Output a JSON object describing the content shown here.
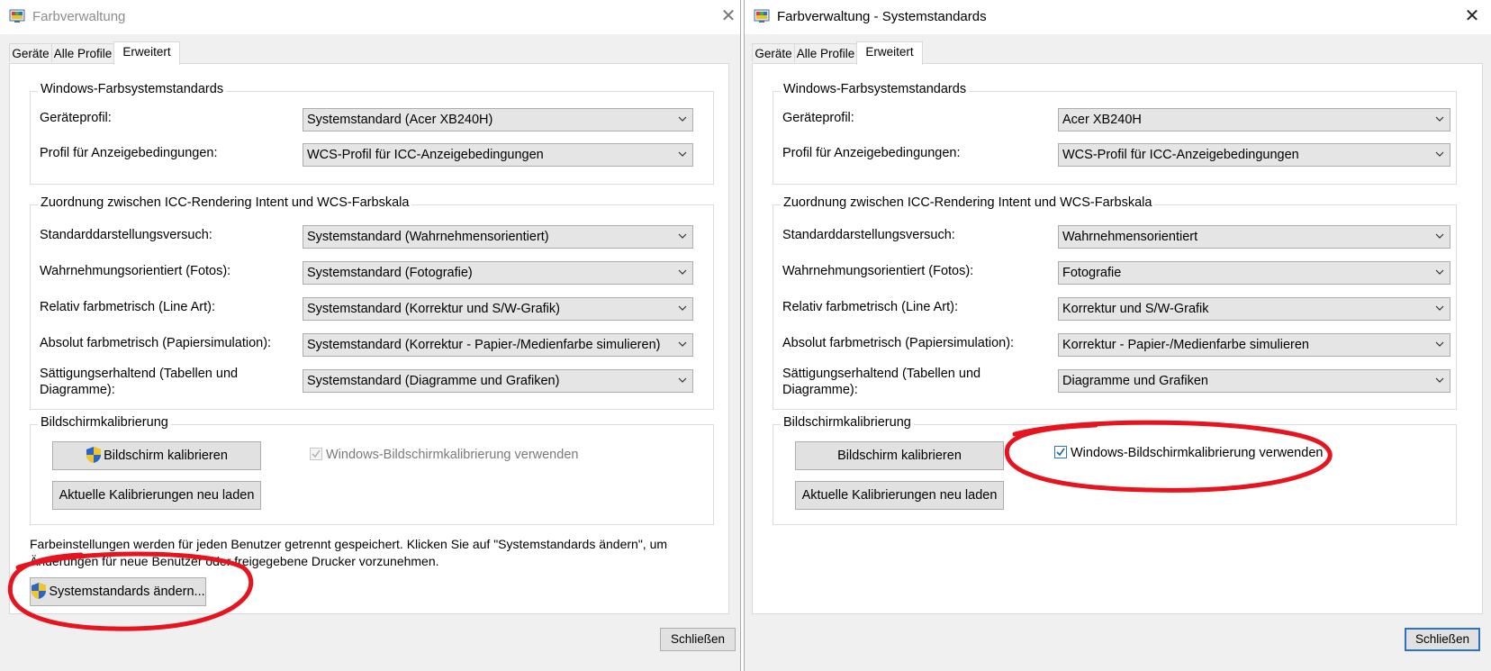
{
  "colors": {
    "annotation": "#e6141e",
    "accent": "#2a73c5",
    "dialog_bg": "#f0f0f0"
  },
  "left": {
    "title": "Farbverwaltung",
    "tabs": [
      {
        "label": "Geräte"
      },
      {
        "label": "Alle Profile"
      },
      {
        "label": "Erweitert"
      }
    ],
    "group1": {
      "title": "Windows-Farbsystemstandards",
      "rows": [
        {
          "label": "Geräteprofil:",
          "value": "Systemstandard (Acer XB240H)"
        },
        {
          "label": "Profil für Anzeigebedingungen:",
          "value": "WCS-Profil für ICC-Anzeigebedingungen"
        }
      ]
    },
    "group2": {
      "title": "Zuordnung zwischen ICC-Rendering Intent und WCS-Farbskala",
      "rows": [
        {
          "label": "Standarddarstellungsversuch:",
          "value": "Systemstandard (Wahrnehmensorientiert)"
        },
        {
          "label": "Wahrnehmungsorientiert (Fotos):",
          "value": "Systemstandard (Fotografie)"
        },
        {
          "label": "Relativ farbmetrisch (Line Art):",
          "value": "Systemstandard (Korrektur und S/W-Grafik)"
        },
        {
          "label": "Absolut farbmetrisch (Papiersimulation):",
          "value": "Systemstandard (Korrektur - Papier-/Medienfarbe simulieren)"
        },
        {
          "label_line1": "Sättigungserhaltend (Tabellen und",
          "label_line2": "Diagramme):",
          "value": "Systemstandard (Diagramme und Grafiken)"
        }
      ]
    },
    "group3": {
      "title": "Bildschirmkalibrierung",
      "calibrate_label": "Bildschirm kalibrieren",
      "reload_label": "Aktuelle Kalibrierungen neu laden",
      "checkbox_label": "Windows-Bildschirmkalibrierung verwenden",
      "checkbox_checked": true,
      "checkbox_enabled": false
    },
    "info_line1": "Farbeinstellungen werden für jeden Benutzer getrennt gespeichert. Klicken Sie auf \"Systemstandards ändern\", um",
    "info_line2": "Änderungen für neue Benutzer oder freigegebene Drucker vorzunehmen.",
    "change_defaults_label": "Systemstandards ändern...",
    "close_label": "Schließen"
  },
  "right": {
    "title": "Farbverwaltung - Systemstandards",
    "tabs": [
      {
        "label": "Geräte"
      },
      {
        "label": "Alle Profile"
      },
      {
        "label": "Erweitert"
      }
    ],
    "group1": {
      "title": "Windows-Farbsystemstandards",
      "rows": [
        {
          "label": "Geräteprofil:",
          "value": "Acer XB240H"
        },
        {
          "label": "Profil für Anzeigebedingungen:",
          "value": "WCS-Profil für ICC-Anzeigebedingungen"
        }
      ]
    },
    "group2": {
      "title": "Zuordnung zwischen ICC-Rendering Intent und WCS-Farbskala",
      "rows": [
        {
          "label": "Standarddarstellungsversuch:",
          "value": "Wahrnehmensorientiert"
        },
        {
          "label": "Wahrnehmungsorientiert (Fotos):",
          "value": "Fotografie"
        },
        {
          "label": "Relativ farbmetrisch (Line Art):",
          "value": "Korrektur und S/W-Grafik"
        },
        {
          "label": "Absolut farbmetrisch (Papiersimulation):",
          "value": "Korrektur - Papier-/Medienfarbe simulieren"
        },
        {
          "label_line1": "Sättigungserhaltend (Tabellen und",
          "label_line2": "Diagramme):",
          "value": "Diagramme und Grafiken"
        }
      ]
    },
    "group3": {
      "title": "Bildschirmkalibrierung",
      "calibrate_label": "Bildschirm kalibrieren",
      "reload_label": "Aktuelle Kalibrierungen neu laden",
      "checkbox_label": "Windows-Bildschirmkalibrierung verwenden",
      "checkbox_checked": true,
      "checkbox_enabled": true
    },
    "close_label": "Schließen"
  }
}
